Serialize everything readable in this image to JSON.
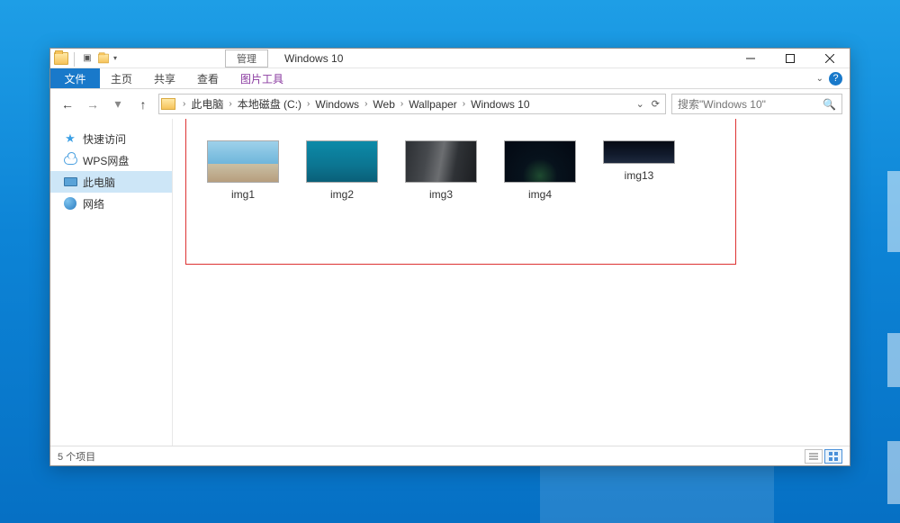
{
  "titlebar": {
    "mgmt": "管理",
    "title": "Windows 10"
  },
  "ribbon": {
    "file": "文件",
    "tabs": [
      "主页",
      "共享",
      "查看"
    ],
    "tool_tab": "图片工具"
  },
  "breadcrumbs": [
    "此电脑",
    "本地磁盘 (C:)",
    "Windows",
    "Web",
    "Wallpaper",
    "Windows 10"
  ],
  "search": {
    "placeholder": "搜索\"Windows 10\""
  },
  "sidebar": {
    "items": [
      {
        "label": "快速访问"
      },
      {
        "label": "WPS网盘"
      },
      {
        "label": "此电脑"
      },
      {
        "label": "网络"
      }
    ]
  },
  "files": [
    {
      "name": "img1"
    },
    {
      "name": "img2"
    },
    {
      "name": "img3"
    },
    {
      "name": "img4"
    },
    {
      "name": "img13"
    }
  ],
  "status": {
    "text": "5 个项目"
  }
}
